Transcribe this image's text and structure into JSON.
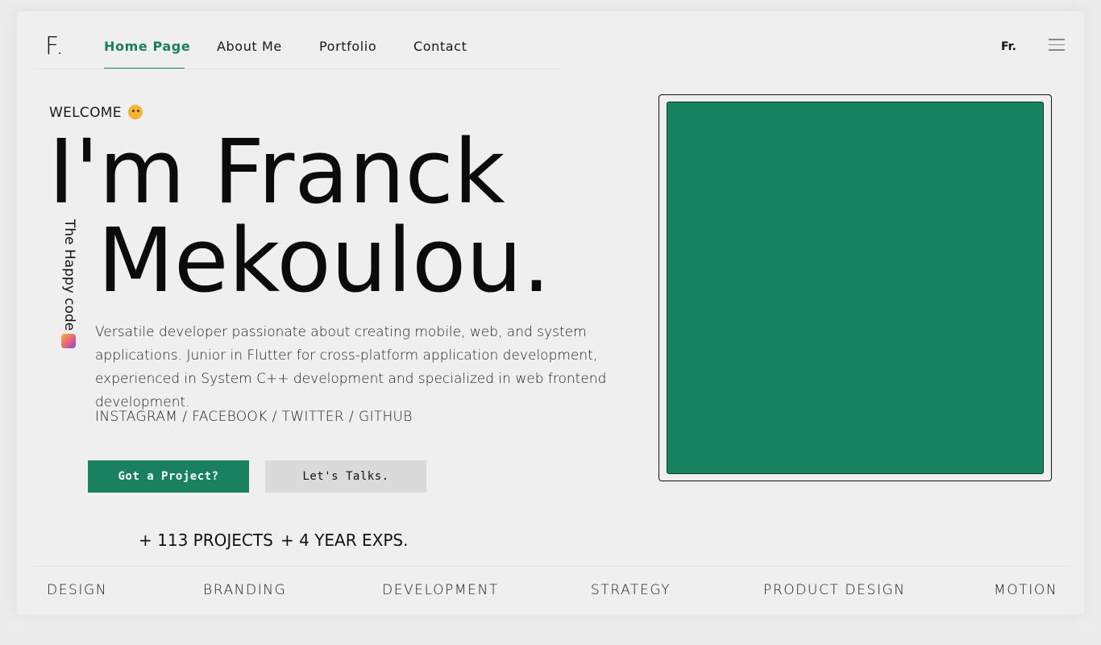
{
  "brand": {
    "logo": "F."
  },
  "nav": {
    "items": [
      {
        "label": "Home Page",
        "active": true
      },
      {
        "label": "About Me"
      },
      {
        "label": "Portfolio"
      },
      {
        "label": "Contact"
      }
    ],
    "language": "Fr.",
    "menu_icon": "hamburger-menu-icon"
  },
  "hero": {
    "welcome": "WELCOME",
    "welcome_icon": "smiling-face-emoji",
    "name_line1": "I'm Franck",
    "name_line2": "Mekoulou.",
    "tagline": "The Happy code",
    "tagline_icon": "party-face-emoji",
    "bio": "Versatile developer passionate about creating mobile, web, and system applications. Junior in Flutter for cross-platform application development, experienced in System C++ development and specialized in web frontend development.",
    "socials": [
      "INSTAGRAM",
      "FACEBOOK",
      "TWITTER",
      "GITHUB"
    ],
    "primary_button": "Got a Project?",
    "secondary_button": "Let's Talks.",
    "stats": [
      "+ 113 PROJECTS",
      "+ 4 YEAR EXPS."
    ]
  },
  "image": {
    "background": "#188360"
  },
  "services": [
    "DESIGN",
    "BRANDING",
    "DEVELOPMENT",
    "STRATEGY",
    "PRODUCT DESIGN",
    "MOTION"
  ],
  "colors": {
    "accent": "#1a8160",
    "background": "#efefef"
  }
}
